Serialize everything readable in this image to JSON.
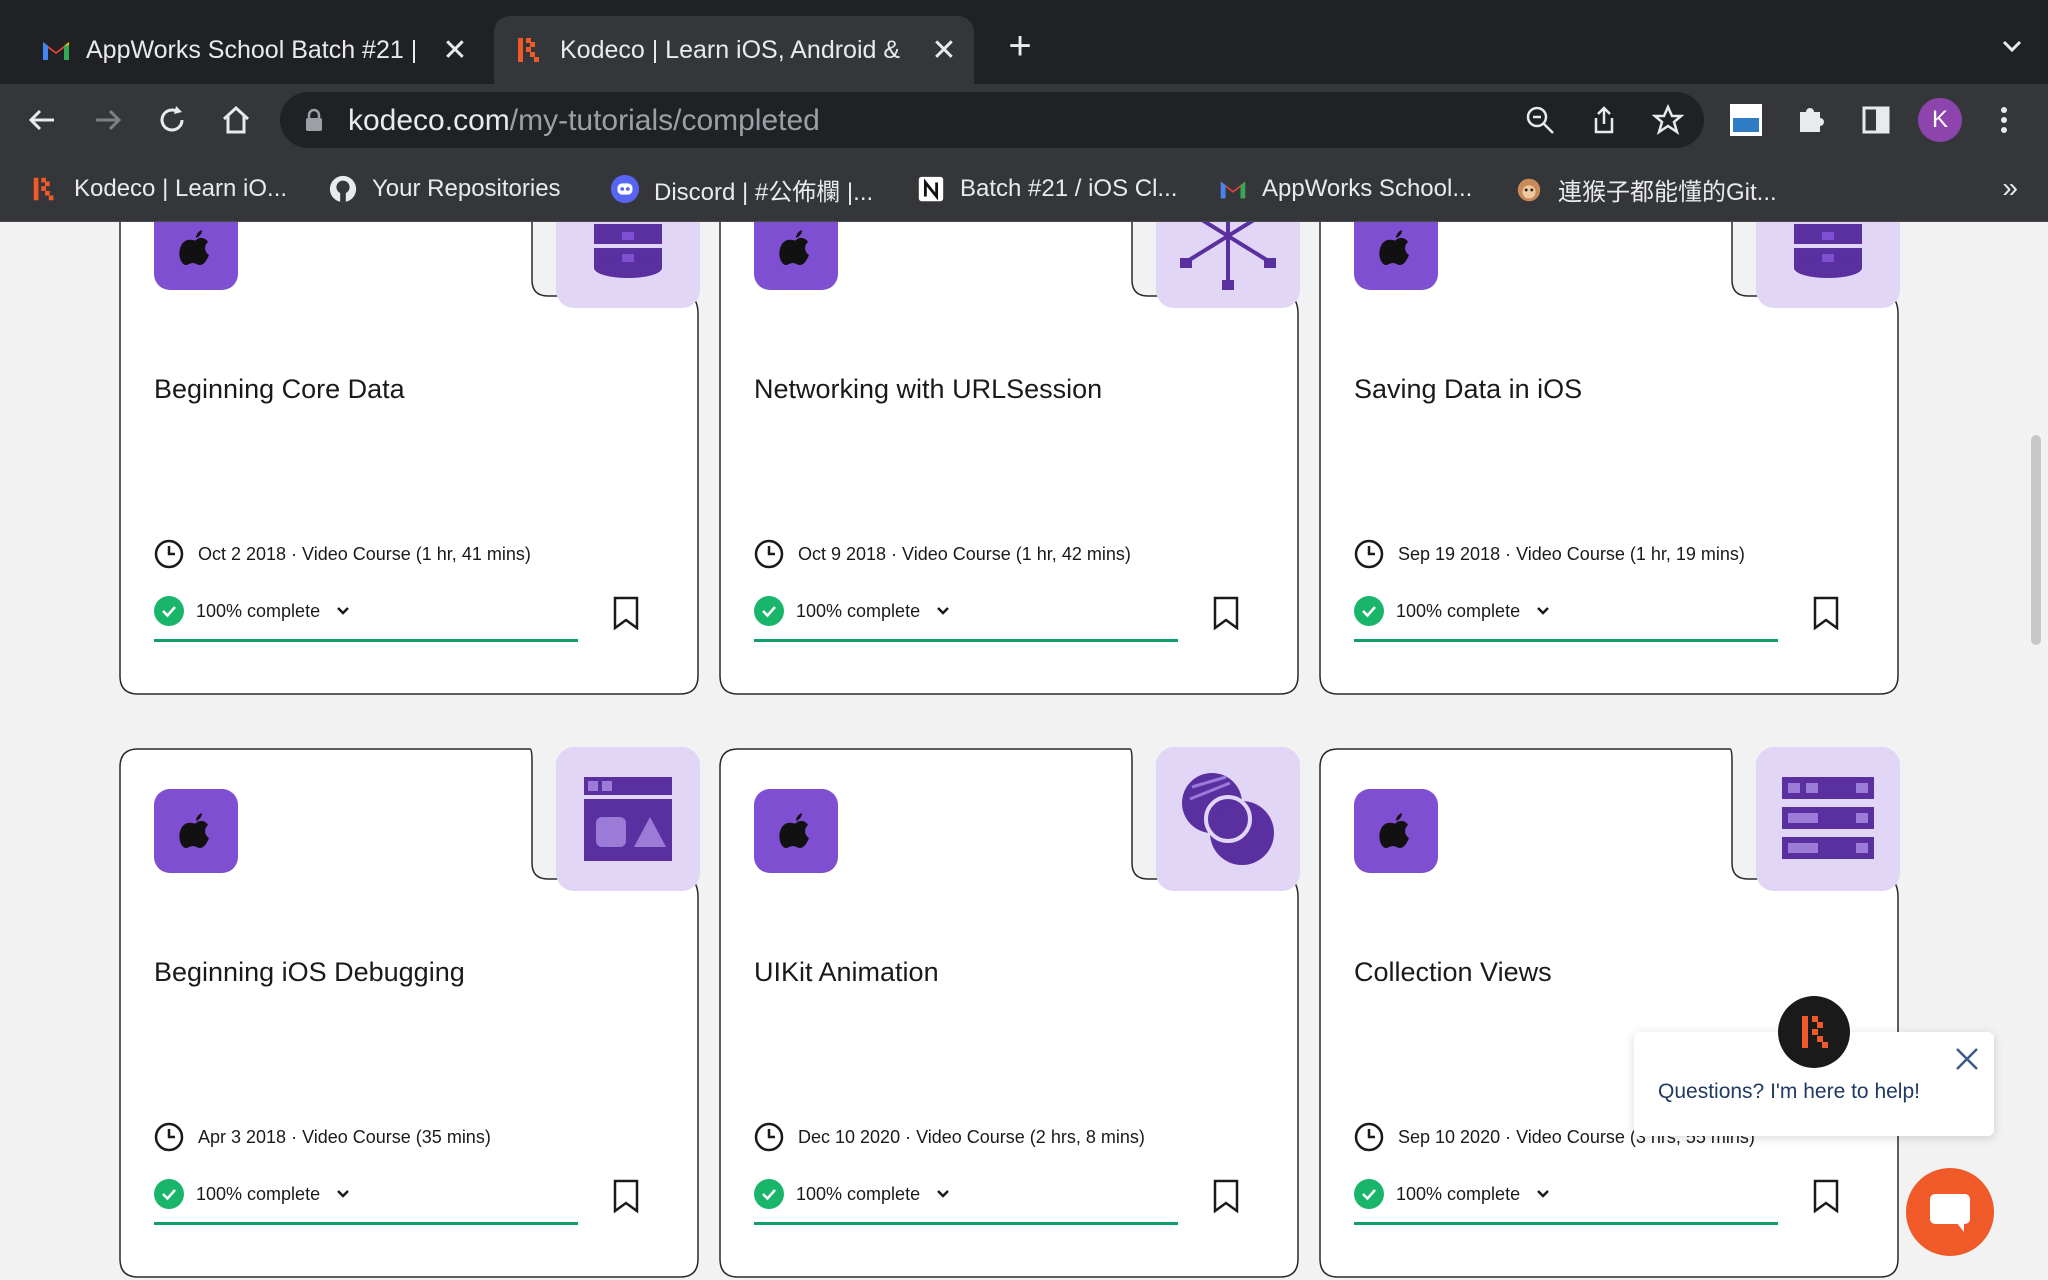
{
  "browser": {
    "tabs": [
      {
        "title": "AppWorks School Batch #21 | ",
        "favicon": "gmail-icon",
        "active": false
      },
      {
        "title": "Kodeco | Learn iOS, Android & ",
        "favicon": "kodeco-icon",
        "active": true
      }
    ],
    "address": {
      "host": "kodeco.com",
      "path": "/my-tutorials/completed"
    },
    "profile_initial": "K",
    "bookmarks": [
      {
        "label": "Kodeco | Learn iO...",
        "icon": "kodeco-icon"
      },
      {
        "label": "Your Repositories",
        "icon": "github-icon"
      },
      {
        "label": "Discord | #公佈欄 |...",
        "icon": "discord-icon"
      },
      {
        "label": "Batch #21 / iOS Cl...",
        "icon": "notion-icon"
      },
      {
        "label": "AppWorks School...",
        "icon": "gmail-icon"
      },
      {
        "label": "連猴子都能懂的Git...",
        "icon": "monkey-icon"
      }
    ],
    "bookmarks_more": "»"
  },
  "courses": [
    {
      "title": "Beginning Core Data",
      "meta": "Oct 2 2018 · Video Course (1 hr, 41 mins)",
      "progress_label": "100% complete",
      "progress": 1.0,
      "art": "database-icon"
    },
    {
      "title": "Networking with URLSession",
      "meta": "Oct 9 2018 · Video Course (1 hr, 42 mins)",
      "progress_label": "100% complete",
      "progress": 1.0,
      "art": "network-icon"
    },
    {
      "title": "Saving Data in iOS",
      "meta": "Sep 19 2018 · Video Course (1 hr, 19 mins)",
      "progress_label": "100% complete",
      "progress": 1.0,
      "art": "database-icon"
    },
    {
      "title": "Beginning iOS Debugging",
      "meta": "Apr 3 2018 · Video Course (35 mins)",
      "progress_label": "100% complete",
      "progress": 1.0,
      "art": "window-shapes-icon"
    },
    {
      "title": "UIKit Animation",
      "meta": "Dec 10 2020 · Video Course (2 hrs, 8 mins)",
      "progress_label": "100% complete",
      "progress": 1.0,
      "art": "overlapping-circles-icon"
    },
    {
      "title": "Collection Views",
      "meta": "Sep 10 2020 · Video Course (3 hrs, 55 mins)",
      "progress_label": "100% complete",
      "progress": 1.0,
      "art": "grid-rows-icon"
    }
  ],
  "chat": {
    "message": "Questions? I'm here to help!"
  },
  "colors": {
    "accent": "#7e4fd0",
    "art_bg": "#e2d6f7",
    "complete": "#18b56b",
    "progress_bar": "#0f9e67",
    "chat_button": "#f05a28"
  }
}
